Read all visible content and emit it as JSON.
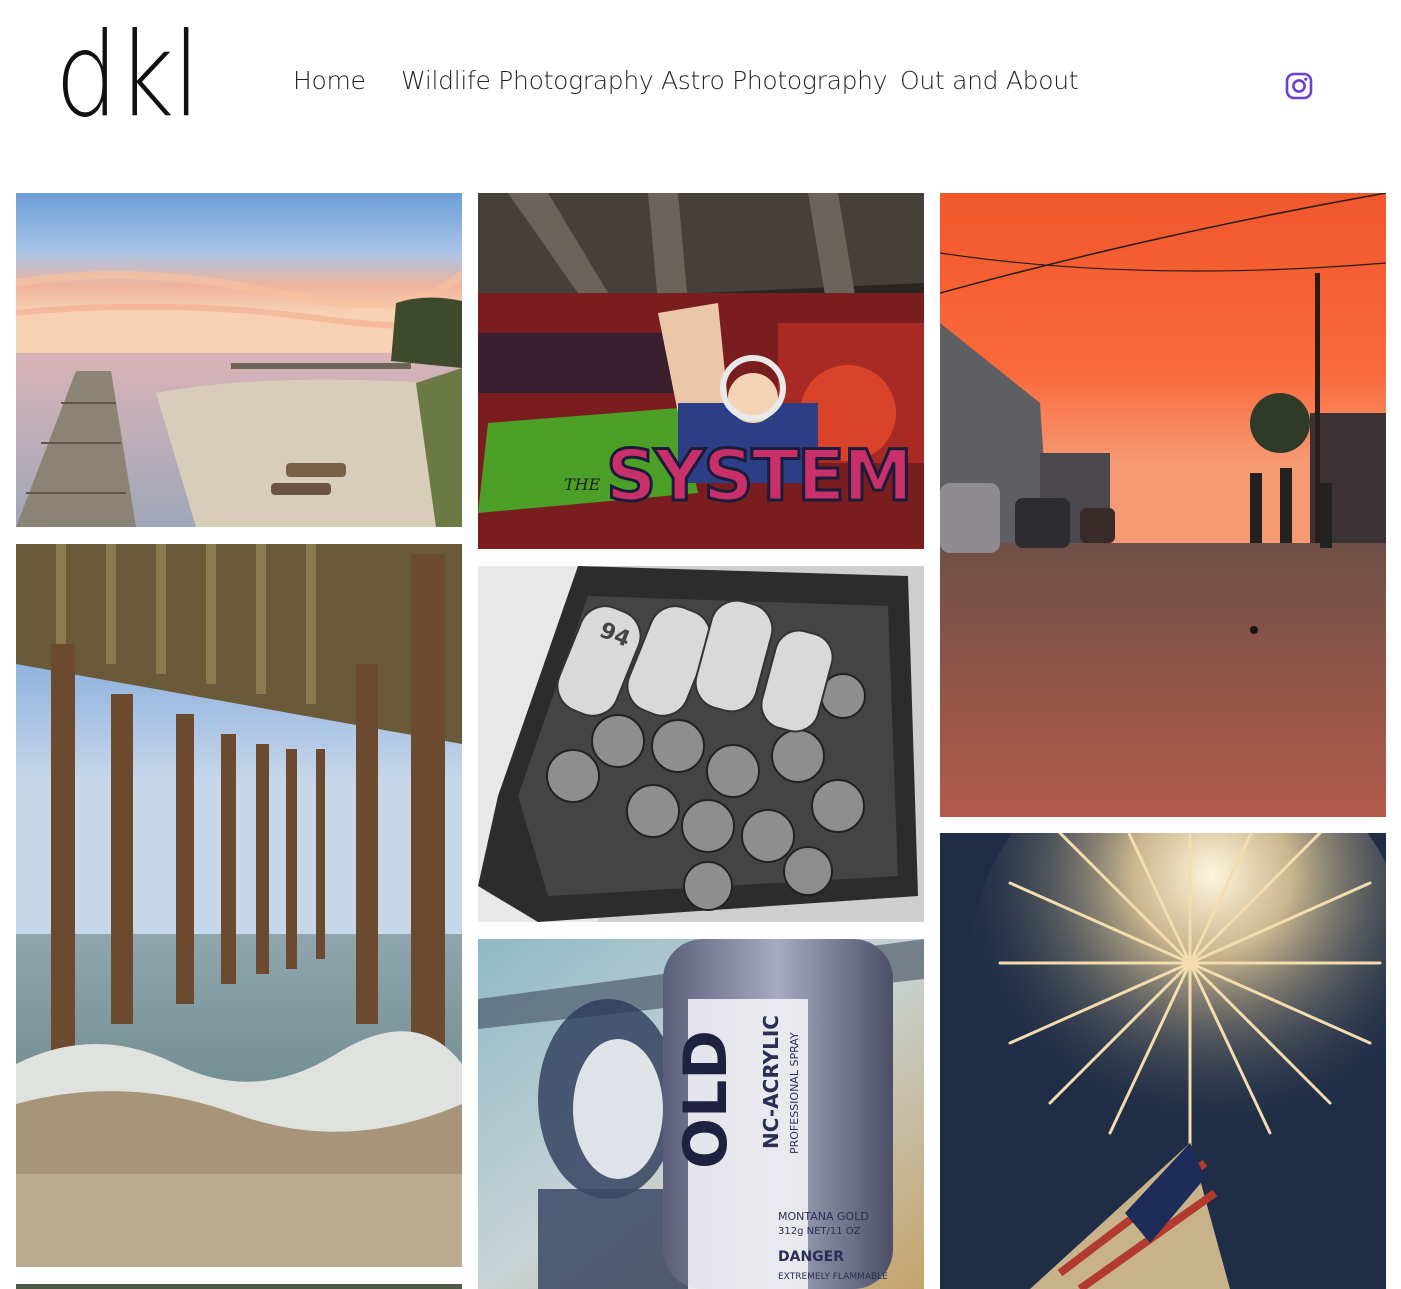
{
  "site": {
    "logo": "dkl"
  },
  "nav": {
    "items": [
      {
        "label": "Home"
      },
      {
        "label": "Wildlife Photography"
      },
      {
        "label": "Astro Photography"
      },
      {
        "label": "Out and About"
      }
    ]
  },
  "social": {
    "instagram_icon": "instagram-icon",
    "accent": "#6b3fd4"
  },
  "gallery": {
    "photos": [
      {
        "subject": "sunset over pier and beach"
      },
      {
        "subject": "graffiti mural under bridge",
        "text_lines": [
          "THE",
          "SYSTEM"
        ]
      },
      {
        "subject": "orange sunset over street"
      },
      {
        "subject": "under a wooden pier with waves"
      },
      {
        "subject": "black and white spray cans in crate",
        "text_lines": [
          "94"
        ]
      },
      {
        "subject": "spray can in front of mural",
        "text_lines": [
          "OLD",
          "NC-ACRYLIC",
          "PROFESSIONAL SPRAY",
          "MONTANA GOLD",
          "312g NET/11 OZ",
          "DANGER",
          "EXTREMELY FLAMMABLE"
        ]
      },
      {
        "subject": "fireworks and american flag"
      }
    ]
  }
}
